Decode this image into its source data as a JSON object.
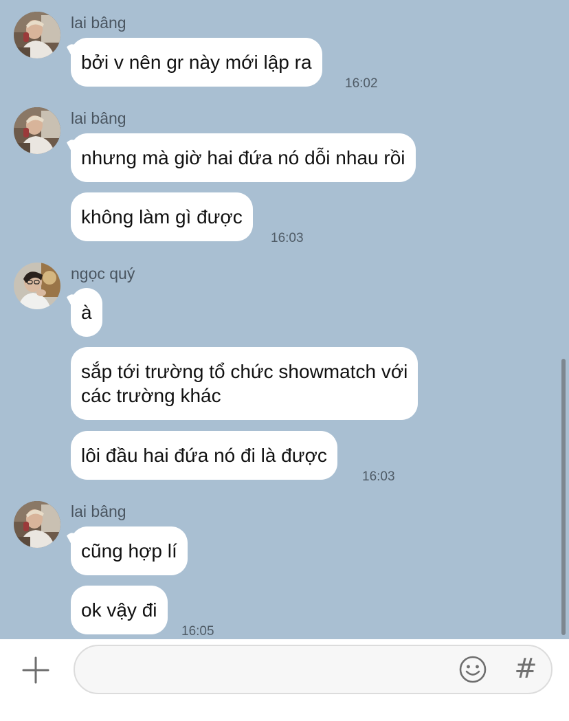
{
  "chat": {
    "groups": [
      {
        "sender": "lai bâng",
        "avatar_icon": "user-avatar-photo-lai-bang",
        "messages": [
          {
            "text": "bởi v nên gr này mới lập ra",
            "time": "16:02"
          }
        ]
      },
      {
        "sender": "lai bâng",
        "avatar_icon": "user-avatar-photo-lai-bang",
        "messages": [
          {
            "text": "nhưng mà giờ hai đứa nó dỗi nhau rồi",
            "time": ""
          },
          {
            "text": "không làm gì được",
            "time": "16:03"
          }
        ]
      },
      {
        "sender": "ngọc quý",
        "avatar_icon": "user-avatar-photo-ngoc-quy",
        "messages": [
          {
            "text": "à",
            "time": ""
          },
          {
            "text_lines": [
              "sắp tới trường tổ chức showmatch với",
              "các trường khác"
            ],
            "time": ""
          },
          {
            "text": "lôi đầu hai đứa nó đi là được",
            "time": "16:03"
          }
        ]
      },
      {
        "sender": "lai bâng",
        "avatar_icon": "user-avatar-photo-lai-bang",
        "messages": [
          {
            "text": "cũng hợp lí",
            "time": ""
          },
          {
            "text": "ok vậy đi",
            "time": "16:05"
          }
        ]
      }
    ]
  },
  "composer": {
    "input_value": "",
    "input_placeholder": "",
    "plus_icon": "plus-icon",
    "emoji_icon": "emoji-icon",
    "hashtag_label": "#"
  },
  "colors": {
    "background": "#a9bfd2",
    "bubble": "#ffffff",
    "composer_bg": "#ffffff"
  }
}
